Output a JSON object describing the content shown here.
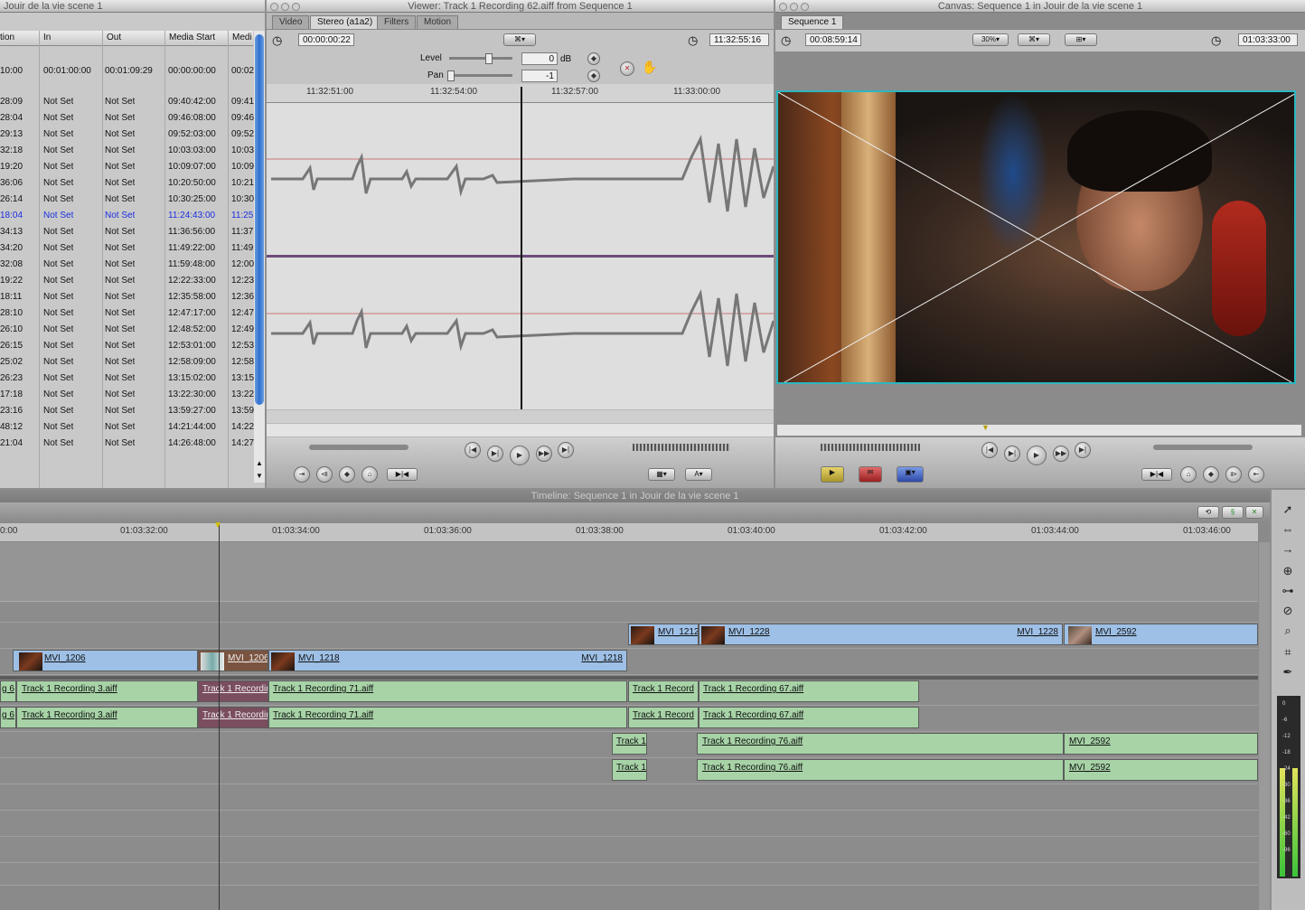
{
  "browser": {
    "title": "Jouir de la vie scene 1",
    "columns": [
      "tion",
      "In",
      "Out",
      "Media Start",
      "Medi"
    ],
    "rows": [
      [
        "10:00",
        "00:01:00:00",
        "00:01:09:29",
        "00:00:00:00",
        "00:02"
      ],
      [
        "28:09",
        "Not Set",
        "Not Set",
        "09:40:42:00",
        "09:41"
      ],
      [
        "28:04",
        "Not Set",
        "Not Set",
        "09:46:08:00",
        "09:46"
      ],
      [
        "29:13",
        "Not Set",
        "Not Set",
        "09:52:03:00",
        "09:52"
      ],
      [
        "32:18",
        "Not Set",
        "Not Set",
        "10:03:03:00",
        "10:03"
      ],
      [
        "19:20",
        "Not Set",
        "Not Set",
        "10:09:07:00",
        "10:09"
      ],
      [
        "36:06",
        "Not Set",
        "Not Set",
        "10:20:50:00",
        "10:21"
      ],
      [
        "26:14",
        "Not Set",
        "Not Set",
        "10:30:25:00",
        "10:30"
      ],
      [
        "18:04",
        "Not Set",
        "Not Set",
        "11:24:43:00",
        "11:25"
      ],
      [
        "34:13",
        "Not Set",
        "Not Set",
        "11:36:56:00",
        "11:37"
      ],
      [
        "34:20",
        "Not Set",
        "Not Set",
        "11:49:22:00",
        "11:49"
      ],
      [
        "32:08",
        "Not Set",
        "Not Set",
        "11:59:48:00",
        "12:00"
      ],
      [
        "19:22",
        "Not Set",
        "Not Set",
        "12:22:33:00",
        "12:23"
      ],
      [
        "18:11",
        "Not Set",
        "Not Set",
        "12:35:58:00",
        "12:36"
      ],
      [
        "28:10",
        "Not Set",
        "Not Set",
        "12:47:17:00",
        "12:47"
      ],
      [
        "26:10",
        "Not Set",
        "Not Set",
        "12:48:52:00",
        "12:49"
      ],
      [
        "26:15",
        "Not Set",
        "Not Set",
        "12:53:01:00",
        "12:53"
      ],
      [
        "25:02",
        "Not Set",
        "Not Set",
        "12:58:09:00",
        "12:58"
      ],
      [
        "26:23",
        "Not Set",
        "Not Set",
        "13:15:02:00",
        "13:15"
      ],
      [
        "17:18",
        "Not Set",
        "Not Set",
        "13:22:30:00",
        "13:22"
      ],
      [
        "23:16",
        "Not Set",
        "Not Set",
        "13:59:27:00",
        "13:59"
      ],
      [
        "48:12",
        "Not Set",
        "Not Set",
        "14:21:44:00",
        "14:22"
      ],
      [
        "21:04",
        "Not Set",
        "Not Set",
        "14:26:48:00",
        "14:27"
      ]
    ],
    "highlight_color": "#1a2fe0"
  },
  "viewer": {
    "title": "Viewer: Track 1 Recording 62.aiff from Sequence 1",
    "tabs": [
      "Video",
      "Stereo (a1a2)",
      "Filters",
      "Motion"
    ],
    "duration": "00:00:00:22",
    "current": "11:32:55:16",
    "level_label": "Level",
    "level_value": "0",
    "level_unit": "dB",
    "pan_label": "Pan",
    "pan_value": "-1",
    "ruler": [
      "11:32:51:00",
      "11:32:54:00",
      "11:32:57:00",
      "11:33:00:00"
    ]
  },
  "canvas": {
    "title": "Canvas: Sequence 1 in Jouir de la vie scene 1",
    "tab": "Sequence 1",
    "duration": "00:08:59:14",
    "zoom": "30%",
    "current": "01:03:33:00"
  },
  "timeline": {
    "title": "Timeline: Sequence 1 in Jouir de la vie scene 1",
    "ruler": [
      "0:00",
      "01:03:32:00",
      "01:03:34:00",
      "01:03:36:00",
      "01:03:38:00",
      "01:03:40:00",
      "01:03:42:00",
      "01:03:44:00",
      "01:03:46:00"
    ],
    "v2": [
      {
        "name": "MVI_1212"
      },
      {
        "name": "MVI_1228",
        "end": "MVI_1228"
      },
      {
        "name": "MVI_2592"
      }
    ],
    "v1": [
      {
        "name": "MVI_1206"
      },
      {
        "name": "MVI_1206"
      },
      {
        "name": "MVI_1218",
        "end": "MVI_1218"
      }
    ],
    "a1": [
      "g 6",
      "Track 1 Recording 3.aiff",
      "Track 1 Recordin",
      "Track 1 Recording 71.aiff",
      "Track 1 Record",
      "Track 1 Recording 67.aiff"
    ],
    "a2": [
      "g 6",
      "Track 1 Recording 3.aiff",
      "Track 1 Recordin",
      "Track 1 Recording 71.aiff",
      "Track 1 Record",
      "Track 1 Recording 67.aiff"
    ],
    "a3": [
      "Track 1",
      "Track 1 Recording 76.aiff",
      "MVI_2592"
    ],
    "a4": [
      "Track 1",
      "Track 1 Recording 76.aiff",
      "MVI_2592"
    ]
  },
  "audio_meter": [
    "0",
    "-6",
    "-12",
    "-18",
    "-24",
    "-30",
    "-36",
    "-42",
    "-60",
    "-96"
  ]
}
